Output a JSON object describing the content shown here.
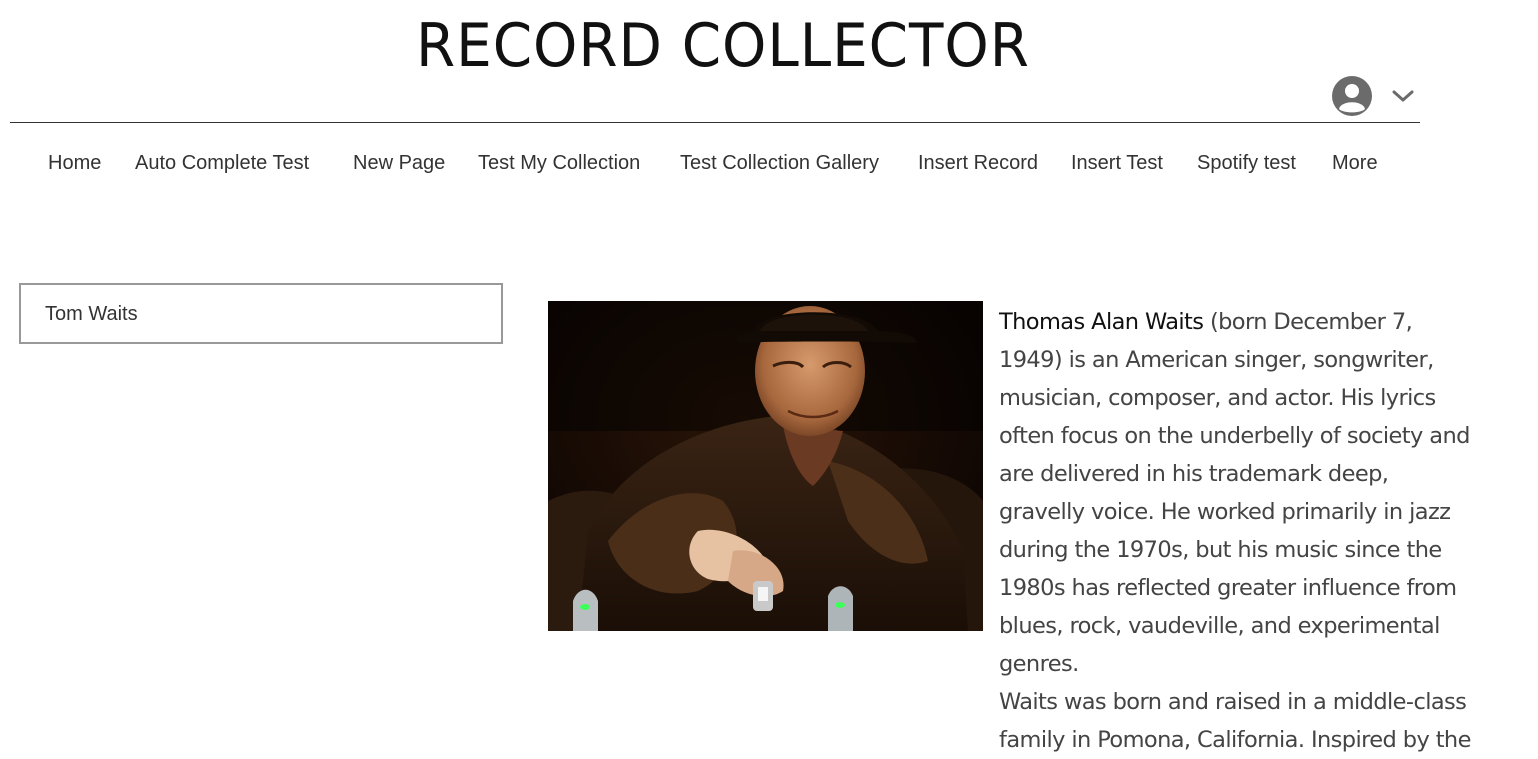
{
  "header": {
    "site_title": "RECORD COLLECTOR",
    "user_icon": "user-avatar-icon",
    "chevron_icon": "chevron-down-icon"
  },
  "nav": {
    "items": [
      {
        "label": "Home"
      },
      {
        "label": "Auto Complete Test"
      },
      {
        "label": "New Page"
      },
      {
        "label": "Test My Collection"
      },
      {
        "label": "Test Collection Gallery"
      },
      {
        "label": "Insert Record"
      },
      {
        "label": "Insert Test"
      },
      {
        "label": "Spotify test"
      },
      {
        "label": "More"
      }
    ]
  },
  "search": {
    "value": "Tom Waits"
  },
  "artist": {
    "photo_icon": "artist-photo",
    "name": "Thomas Alan Waits",
    "bio_line1_rest": " (born December 7,",
    "bio_rest": "1949) is an American singer, songwriter, musician, composer, and actor. His lyrics often focus on the underbelly of society and are delivered in his trademark deep, gravelly voice. He worked primarily in jazz during the 1970s, but his music since the 1980s has reflected greater influence from blues, rock, vaudeville, and experimental genres.",
    "bio_para2": "Waits was born and raised in a middle-class family in Pomona, California. Inspired by the"
  },
  "colors": {
    "rule": "#333333",
    "avatar": "#5f6368",
    "text": "#444444"
  }
}
